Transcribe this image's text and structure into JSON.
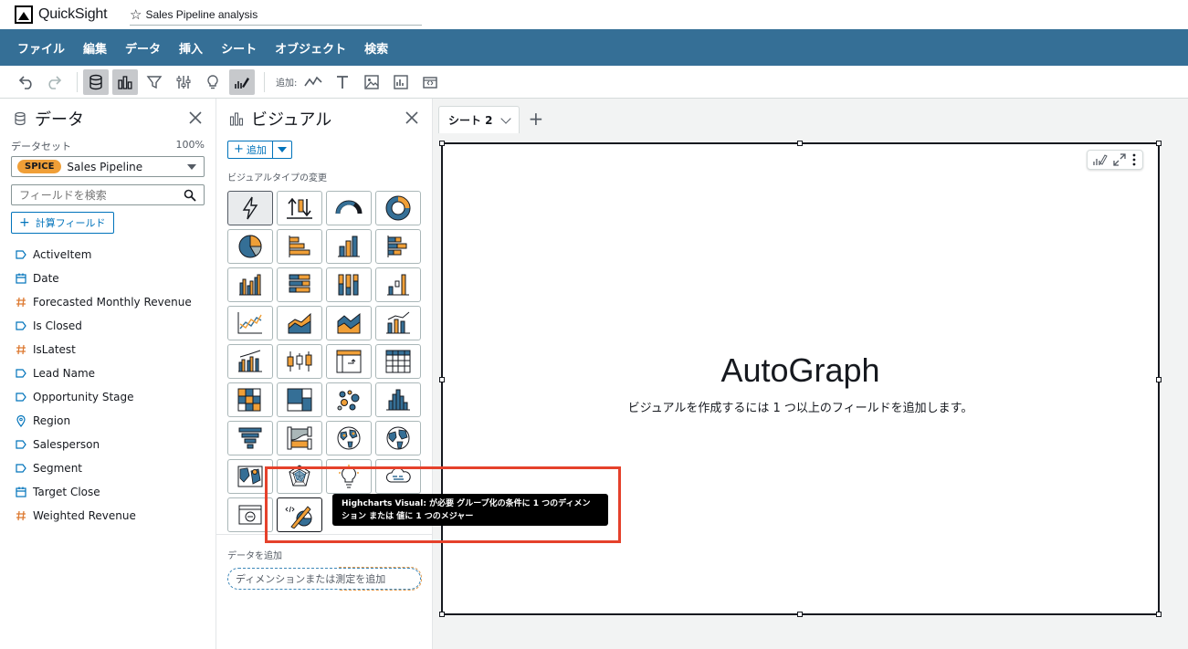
{
  "app": {
    "name": "QuickSight",
    "analysis_title": "Sales Pipeline analysis"
  },
  "menu": [
    "ファイル",
    "編集",
    "データ",
    "挿入",
    "シート",
    "オブジェクト",
    "検索"
  ],
  "toolbar": {
    "add_label": "追加:"
  },
  "data_pane": {
    "title": "データ",
    "dataset_label": "データセット",
    "dataset_percent": "100%",
    "spice_badge": "SPICE",
    "dataset_name": "Sales Pipeline",
    "search_placeholder": "フィールドを検索",
    "calc_field_label": "計算フィールド",
    "fields": [
      {
        "name": "ActiveItem",
        "type": "dimension"
      },
      {
        "name": "Date",
        "type": "date"
      },
      {
        "name": "Forecasted Monthly Revenue",
        "type": "measure"
      },
      {
        "name": "Is Closed",
        "type": "dimension"
      },
      {
        "name": "IsLatest",
        "type": "measure"
      },
      {
        "name": "Lead Name",
        "type": "dimension"
      },
      {
        "name": "Opportunity Stage",
        "type": "dimension"
      },
      {
        "name": "Region",
        "type": "geo"
      },
      {
        "name": "Salesperson",
        "type": "dimension"
      },
      {
        "name": "Segment",
        "type": "dimension"
      },
      {
        "name": "Target Close",
        "type": "date"
      },
      {
        "name": "Weighted Revenue",
        "type": "measure"
      }
    ]
  },
  "visual_pane": {
    "title": "ビジュアル",
    "add_label": "追加",
    "change_type_label": "ビジュアルタイプの変更",
    "add_data_label": "データを追加",
    "drop_placeholder": "ディメンションまたは測定を追加"
  },
  "canvas": {
    "sheet_tab": "シート 2",
    "autograph_title": "AutoGraph",
    "autograph_sub": "ビジュアルを作成するには 1 つ以上のフィールドを追加します。"
  },
  "tooltip": {
    "line1": "Highcharts Visual: が必要 グループ化の条件に 1 つのディメン",
    "line2": "ション または 値に 1 つのメジャー"
  },
  "colors": {
    "menubar": "#356f96",
    "accent": "#0073bb",
    "spice": "#f09f37",
    "highlight": "#e5412b"
  }
}
